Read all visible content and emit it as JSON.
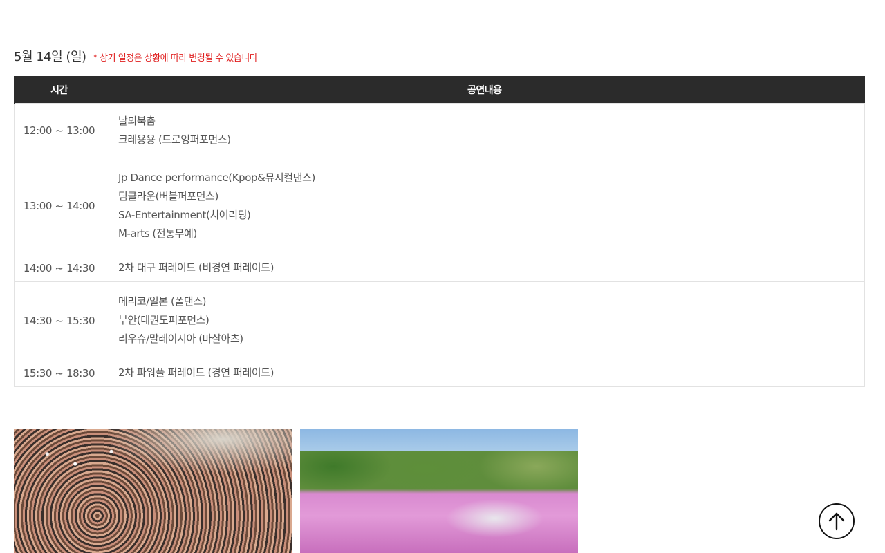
{
  "header": {
    "date_title": "5월 14일 (일)",
    "notice": "* 상기 일정은 상황에 따라 변경될 수 있습니다"
  },
  "table": {
    "columns": [
      "시간",
      "공연내용"
    ],
    "rows": [
      {
        "time": "12:00 ~ 13:00",
        "lines": [
          "날뫼북춤",
          "크레용용 (드로잉퍼포먼스)"
        ]
      },
      {
        "time": "13:00 ~ 14:00",
        "lines": [
          "Jp Dance performance(Kpop&뮤지컬댄스)",
          "팀클라운(버블퍼포먼스)",
          "SA-Entertainment(치어리딩)",
          "M-arts (전통무예)"
        ]
      },
      {
        "time": "14:00 ~ 14:30",
        "lines": [
          "2차 대구 퍼레이드 (비경연 퍼레이드)"
        ]
      },
      {
        "time": "14:30 ~ 15:30",
        "lines": [
          "메리코/일본 (폴댄스)",
          "부안(태권도퍼포먼스)",
          "리우슈/말레이시아 (마샬아츠)"
        ]
      },
      {
        "time": "15:30 ~ 18:30",
        "lines": [
          "2차 파워풀 퍼레이드 (경연 퍼레이드)"
        ]
      }
    ]
  },
  "icons": {
    "scroll_top": "arrow-up-icon"
  },
  "colors": {
    "header_bg": "#2b2b2b",
    "notice": "#e02020",
    "border": "#e2e2e2"
  }
}
